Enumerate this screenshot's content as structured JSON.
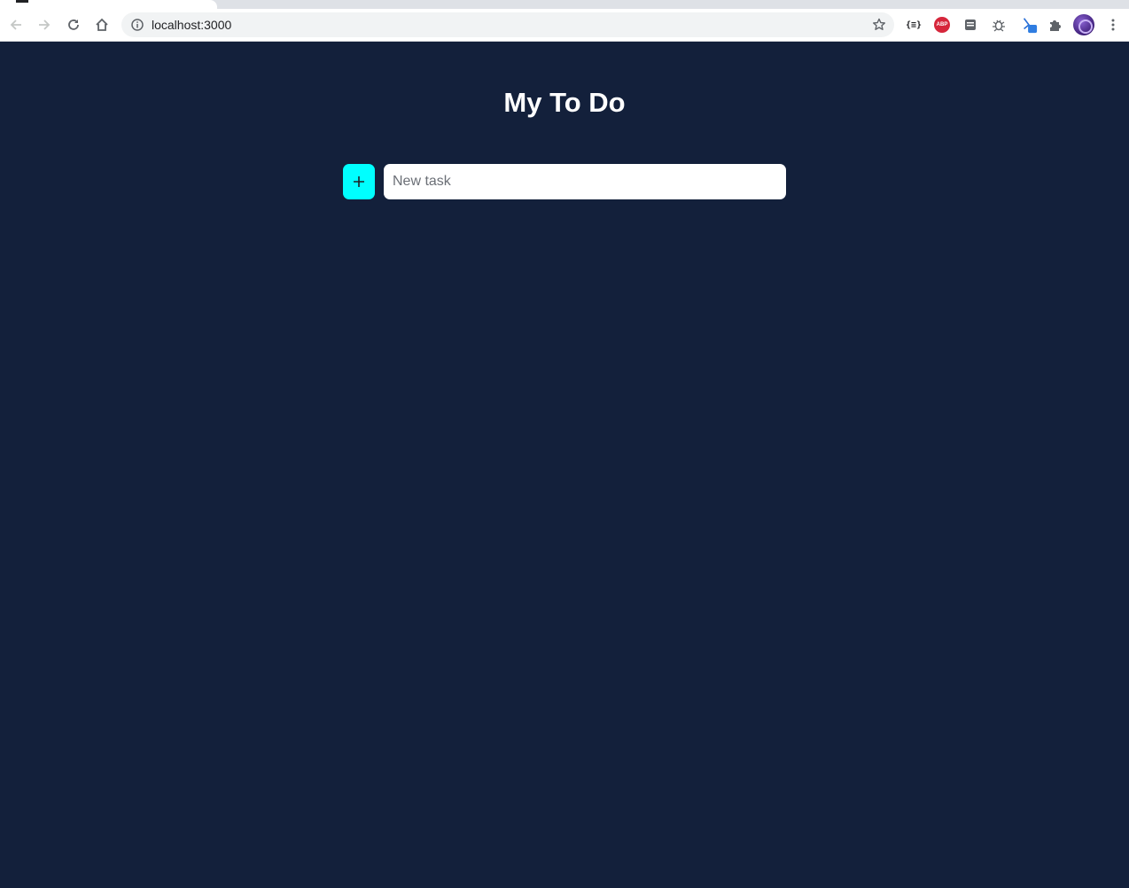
{
  "browser": {
    "url": "localhost:3000",
    "toolbar_icons": [
      "back-icon",
      "forward-icon",
      "reload-icon",
      "home-icon",
      "info-icon",
      "star-icon"
    ],
    "extensions": [
      {
        "name": "json-braces-extension-icon",
        "label": "{≡}"
      },
      {
        "name": "adblock-plus-icon",
        "label": "ABP"
      },
      {
        "name": "notes-extension-icon"
      },
      {
        "name": "bug-extension-icon"
      },
      {
        "name": "selector-extension-icon"
      },
      {
        "name": "extensions-puzzle-icon"
      }
    ],
    "menu_icon": "kebab-menu-icon"
  },
  "app": {
    "title": "My To Do",
    "add_button_label": "+",
    "new_task_placeholder": "New task",
    "new_task_value": ""
  },
  "colors": {
    "background": "#13203b",
    "accent": "#00ffff",
    "input_background": "#ffffff",
    "title_text": "#ffffff"
  }
}
